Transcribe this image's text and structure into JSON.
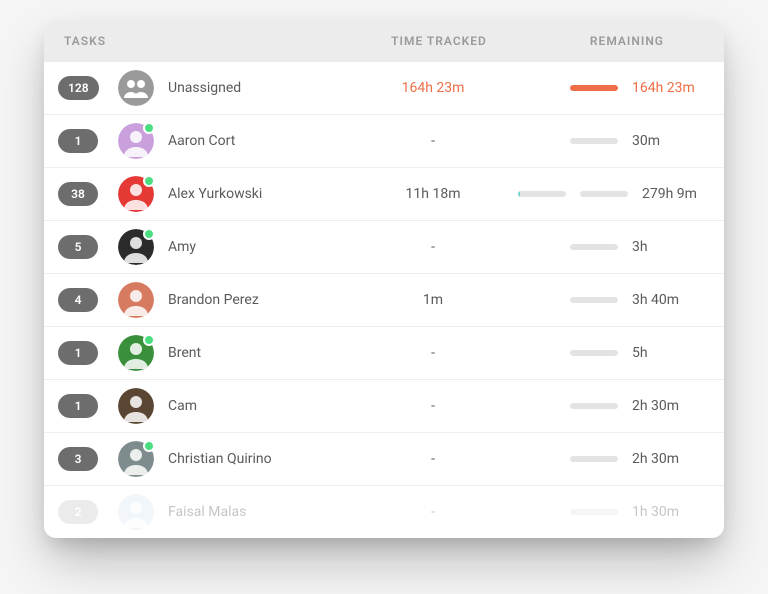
{
  "header": {
    "tasks": "TASKS",
    "tracked": "TIME TRACKED",
    "remaining": "REMAINING"
  },
  "rows": [
    {
      "count": "128",
      "name": "Unassigned",
      "tracked": "164h 23m",
      "remaining": "164h 23m",
      "highlight": true,
      "avatarType": "group",
      "avatarColor": "#9a9a9a",
      "online": false,
      "trackedBar": false
    },
    {
      "count": "1",
      "name": "Aaron Cort",
      "tracked": "-",
      "remaining": "30m",
      "highlight": false,
      "avatarType": "person",
      "avatarColor": "#c9a0dc",
      "online": true,
      "trackedBar": false
    },
    {
      "count": "38",
      "name": "Alex Yurkowski",
      "tracked": "11h 18m",
      "remaining": "279h 9m",
      "highlight": false,
      "avatarType": "person",
      "avatarColor": "#e53935",
      "online": true,
      "trackedBar": true
    },
    {
      "count": "5",
      "name": "Amy",
      "tracked": "-",
      "remaining": "3h",
      "highlight": false,
      "avatarType": "person",
      "avatarColor": "#2b2b2b",
      "online": true,
      "trackedBar": false
    },
    {
      "count": "4",
      "name": "Brandon Perez",
      "tracked": "1m",
      "remaining": "3h 40m",
      "highlight": false,
      "avatarType": "person",
      "avatarColor": "#d67b5f",
      "online": false,
      "trackedBar": false
    },
    {
      "count": "1",
      "name": "Brent",
      "tracked": "-",
      "remaining": "5h",
      "highlight": false,
      "avatarType": "person",
      "avatarColor": "#3a8f3a",
      "online": true,
      "trackedBar": false
    },
    {
      "count": "1",
      "name": "Cam",
      "tracked": "-",
      "remaining": "2h 30m",
      "highlight": false,
      "avatarType": "person",
      "avatarColor": "#5a4632",
      "online": false,
      "trackedBar": false
    },
    {
      "count": "3",
      "name": "Christian Quirino",
      "tracked": "-",
      "remaining": "2h 30m",
      "highlight": false,
      "avatarType": "person",
      "avatarColor": "#7f8c8d",
      "online": true,
      "trackedBar": false
    },
    {
      "count": "2",
      "name": "Faisal Malas",
      "tracked": "-",
      "remaining": "1h 30m",
      "highlight": false,
      "avatarType": "person",
      "avatarColor": "#d9e6f2",
      "online": false,
      "trackedBar": false,
      "faded": true
    }
  ]
}
